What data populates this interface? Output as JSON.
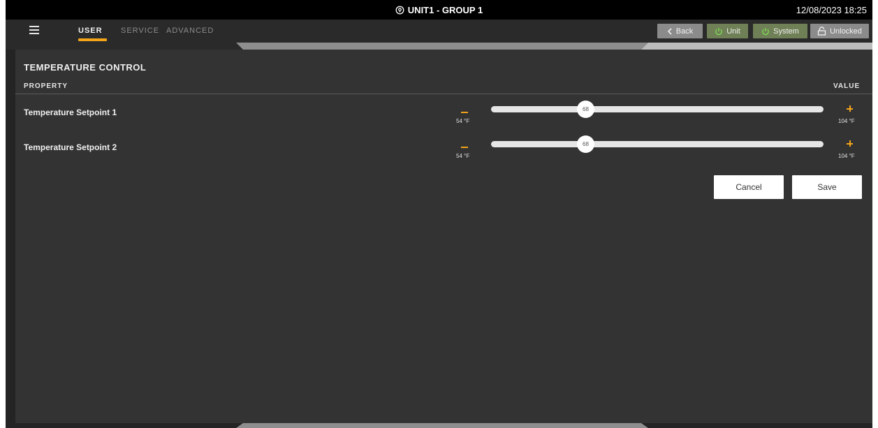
{
  "titlebar": {
    "location": "UNIT1 - GROUP 1",
    "datetime": "12/08/2023 18:25"
  },
  "nav": {
    "tabs": [
      {
        "label": "USER",
        "active": true
      },
      {
        "label": "SERVICE",
        "active": false
      },
      {
        "label": "ADVANCED",
        "active": false
      }
    ],
    "back_label": "Back",
    "unit_label": "Unit",
    "system_label": "System",
    "lock_label": "Unlocked"
  },
  "section": {
    "title": "TEMPERATURE CONTROL",
    "property_header": "PROPERTY",
    "value_header": "VALUE"
  },
  "setpoints": [
    {
      "label": "Temperature Setpoint 1",
      "value": "68",
      "min_label": "54 °F",
      "max_label": "104 °F",
      "min": 54,
      "max": 104
    },
    {
      "label": "Temperature Setpoint 2",
      "value": "68",
      "min_label": "54 °F",
      "max_label": "104 °F",
      "min": 54,
      "max": 104
    }
  ],
  "actions": {
    "cancel_label": "Cancel",
    "save_label": "Save"
  },
  "colors": {
    "accent": "#f3a51a",
    "power_green": "#7ed957",
    "panel": "#333333",
    "background": "#242424"
  },
  "icons": [
    "location-pin-icon",
    "hamburger-menu-icon",
    "chevron-left-icon",
    "power-icon",
    "unlock-icon",
    "minus-icon",
    "plus-icon"
  ]
}
